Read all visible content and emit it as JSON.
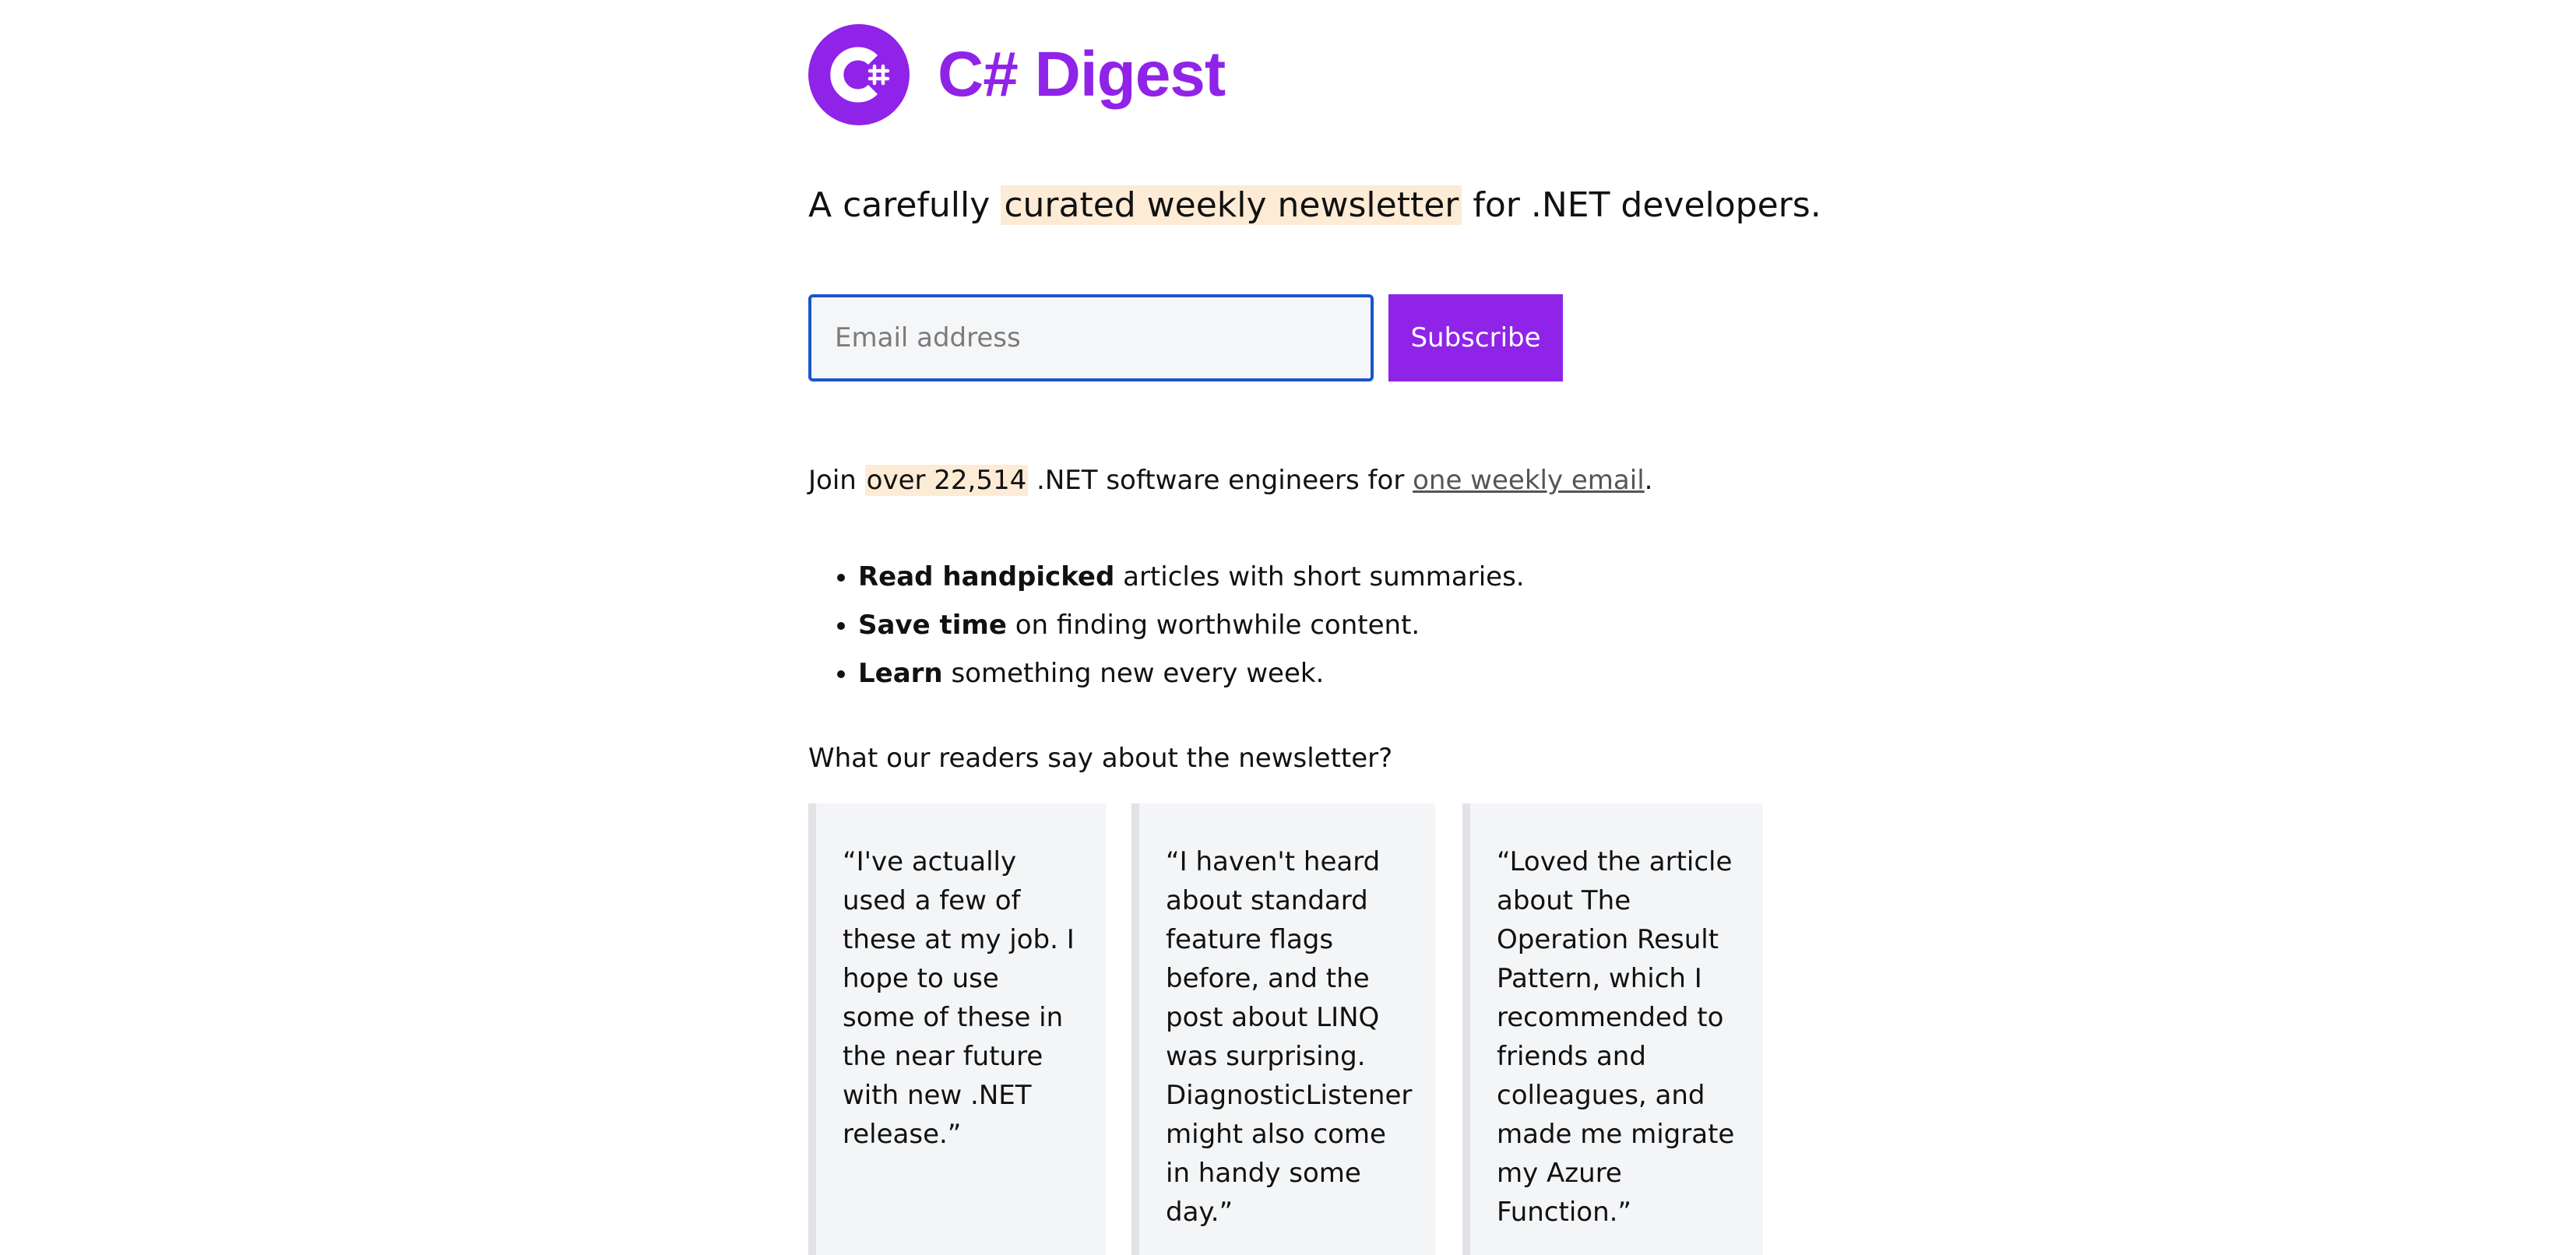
{
  "brand": {
    "name": "C# Digest",
    "color": "#9023e8",
    "logo_icon": "csharp-logo-icon"
  },
  "tagline": {
    "before": "A carefully",
    "highlight": "curated weekly newsletter",
    "after": "for .NET developers."
  },
  "signup": {
    "email_placeholder": "Email address",
    "email_value": "",
    "subscribe_label": "Subscribe",
    "input_border_color": "#1a56c9"
  },
  "join": {
    "prefix": "Join",
    "highlight": "over 22,514",
    "middle": ".NET software engineers for",
    "link": "one weekly email",
    "suffix": "."
  },
  "benefits": [
    {
      "bold": "Read handpicked",
      "text": "articles with short summaries."
    },
    {
      "bold": "Save time",
      "text": "on finding worthwhile content."
    },
    {
      "bold": "Learn",
      "text": "something new every week."
    }
  ],
  "readers_heading": "What our readers say about the newsletter?",
  "testimonials": [
    {
      "quote": "“I've actually used a few of these at my job. I hope to use some of these in the near future with new .NET release.”"
    },
    {
      "quote": "“I haven't heard about standard feature flags before, and the post about LINQ was surprising. DiagnosticListener might also come in handy some day.”"
    },
    {
      "quote": "“Loved the article about The Operation Result Pattern, which I recommended to friends and colleagues, and made me migrate my Azure Function.”"
    }
  ],
  "colors": {
    "highlight_bg": "#fdebd5",
    "card_bg": "#f4f5f7",
    "card_border": "#e2e3e7"
  }
}
